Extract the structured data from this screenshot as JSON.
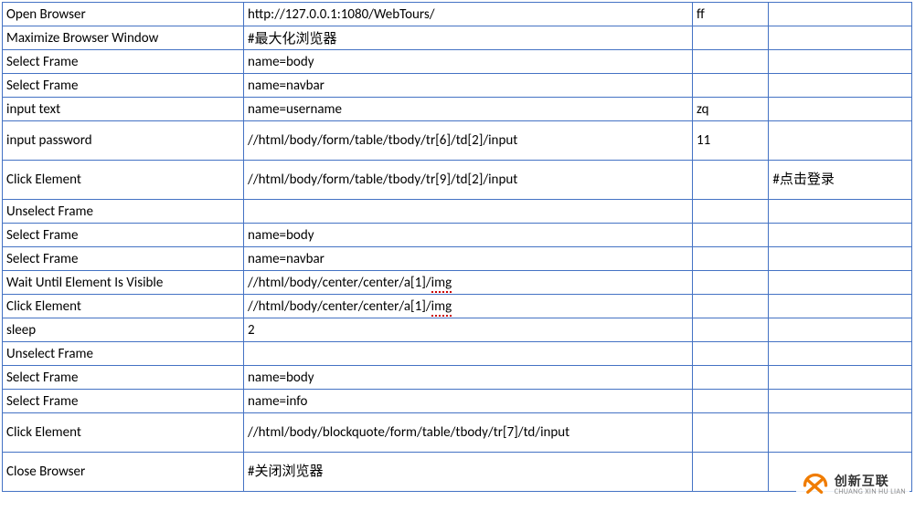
{
  "rows": [
    {
      "c1": "Open Browser",
      "c2": "http://127.0.0.1:1080/WebTours/",
      "c3": "ff",
      "c4": "",
      "tall": false,
      "spell": false
    },
    {
      "c1": "Maximize Browser Window",
      "c2": "#最大化浏览器",
      "c3": "",
      "c4": "",
      "tall": false,
      "spell": false
    },
    {
      "c1": "Select Frame",
      "c2": "name=body",
      "c3": "",
      "c4": "",
      "tall": false,
      "spell": false
    },
    {
      "c1": "Select Frame",
      "c2": "name=navbar",
      "c3": "",
      "c4": "",
      "tall": false,
      "spell": false
    },
    {
      "c1": "input text",
      "c2": "name=username",
      "c3": "zq",
      "c4": "",
      "tall": false,
      "spell": false
    },
    {
      "c1": "input password",
      "c2": "//html/body/form/table/tbody/tr[6]/td[2]/input",
      "c3": "11",
      "c4": "",
      "tall": true,
      "spell": false
    },
    {
      "c1": "Click Element",
      "c2": "//html/body/form/table/tbody/tr[9]/td[2]/input",
      "c3": "",
      "c4": "#点击登录",
      "tall": true,
      "spell": false
    },
    {
      "c1": "Unselect Frame",
      "c2": "",
      "c3": "",
      "c4": "",
      "tall": false,
      "spell": false
    },
    {
      "c1": "Select Frame",
      "c2": "name=body",
      "c3": "",
      "c4": "",
      "tall": false,
      "spell": false
    },
    {
      "c1": "Select Frame",
      "c2": "name=navbar",
      "c3": "",
      "c4": "",
      "tall": false,
      "spell": false
    },
    {
      "c1": "Wait Until Element Is Visible",
      "c2": "//html/body/center/center/a[1]/img",
      "c3": "",
      "c4": "",
      "tall": false,
      "spell": true
    },
    {
      "c1": "Click Element",
      "c2": "//html/body/center/center/a[1]/img",
      "c3": "",
      "c4": "",
      "tall": false,
      "spell": true
    },
    {
      "c1": "sleep",
      "c2": "2",
      "c3": "",
      "c4": "",
      "tall": false,
      "spell": false
    },
    {
      "c1": "Unselect Frame",
      "c2": "",
      "c3": "",
      "c4": "",
      "tall": false,
      "spell": false
    },
    {
      "c1": "Select Frame",
      "c2": "name=body",
      "c3": "",
      "c4": "",
      "tall": false,
      "spell": false
    },
    {
      "c1": "Select Frame",
      "c2": "name=info",
      "c3": "",
      "c4": "",
      "tall": false,
      "spell": false
    },
    {
      "c1": "Click Element",
      "c2": "//html/body/blockquote/form/table/tbody/tr[7]/td/input",
      "c3": "",
      "c4": "",
      "tall": true,
      "spell": false
    },
    {
      "c1": "Close Browser",
      "c2": "#关闭浏览器",
      "c3": "",
      "c4": "",
      "tall": true,
      "spell": false
    }
  ],
  "logo": {
    "cn": "创新互联",
    "en": "CHUANG XIN HU LIAN"
  }
}
